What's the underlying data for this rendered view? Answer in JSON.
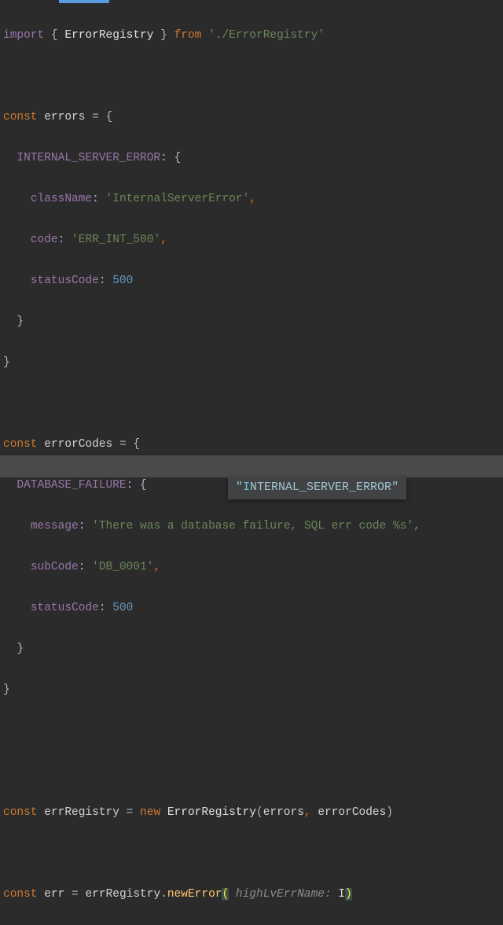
{
  "code": {
    "import_kw": "import",
    "import_open": " { ",
    "import_sym": "ErrorRegistry",
    "import_close": " } ",
    "from_kw": "from",
    "import_path": " './ErrorRegistry'",
    "const_kw": "const",
    "errors_var": " errors ",
    "eq_open": "= {",
    "internal_key": "INTERNAL_SERVER_ERROR",
    "colon_open": ": {",
    "className_key": "className",
    "className_val": "'InternalServerError'",
    "code_key": "code",
    "code_val": "'ERR_INT_500'",
    "statusCode_key": "statusCode",
    "statusCode_val": "500",
    "close_brace": "}",
    "errorCodes_var": " errorCodes ",
    "dbfail_key": "DATABASE_FAILURE",
    "message_key": "message",
    "message_val": "'There was a database failure, SQL err code %s'",
    "subCode_key": "subCode",
    "subCode_val": "'DB_0001'",
    "errRegistry_var": " errRegistry ",
    "eq": "= ",
    "new_kw": "new",
    "ctor": " ErrorRegistry",
    "ctor_args_open": "(",
    "ctor_arg1": "errors",
    "ctor_comma": ", ",
    "ctor_arg2": "errorCodes",
    "ctor_args_close": ")",
    "err_var": " err ",
    "errRegistry_ref": "errRegistry",
    "dot": ".",
    "method": "newError",
    "call_open": "(",
    "param_hint": " highLvErrName: ",
    "param_arg": "I",
    "call_close": ")",
    "comma": ",",
    "colon": ": "
  },
  "tooltip": {
    "quote_open": "\"",
    "hl": "I",
    "rest": "NTERNAL_SERVER_ERROR",
    "quote_close": "\""
  }
}
